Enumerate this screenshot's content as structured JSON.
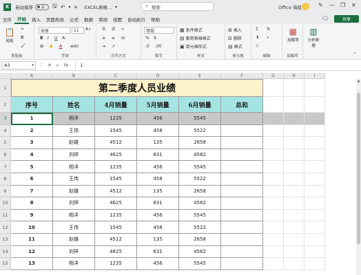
{
  "titlebar": {
    "logo": "X",
    "autosave_label": "自动保存",
    "autosave_state": "关",
    "filename": "EXCEL表格...",
    "search_placeholder": "搜索",
    "user": "Office 海蓝",
    "min": "—",
    "restore": "❐",
    "close": "✕"
  },
  "menu": {
    "items": [
      "文件",
      "开始",
      "插入",
      "页面布局",
      "公式",
      "数据",
      "审阅",
      "视图",
      "自动执行",
      "帮助"
    ],
    "active": "开始",
    "share_label": "共享"
  },
  "ribbon": {
    "clipboard": {
      "paste": "粘贴",
      "label": "剪贴板"
    },
    "font": {
      "name": "宋体",
      "size": "11",
      "label": "字体",
      "bold": "B",
      "italic": "I",
      "underline": "U",
      "wen": "wén"
    },
    "align": {
      "label": "对齐方式"
    },
    "number": {
      "format": "常规",
      "label": "数字",
      "percent": "%",
      "comma": "9"
    },
    "styles": {
      "conditional": "条件格式",
      "table": "套用表格格式",
      "cell": "单元格样式",
      "label": "样式"
    },
    "cells": {
      "insert": "插入",
      "delete": "删除",
      "format": "格式",
      "label": "单元格"
    },
    "editing": {
      "label": "编辑"
    },
    "addins": {
      "addin": "加载项",
      "label": "加载项"
    },
    "analyze": {
      "label": "分析数据"
    }
  },
  "formula_bar": {
    "name_box": "A3",
    "cancel": "✕",
    "enter": "✓",
    "fx": "fx",
    "content": "1"
  },
  "grid": {
    "columns": [
      "A",
      "B",
      "C",
      "D",
      "E",
      "F",
      "G",
      "H",
      "I"
    ],
    "row_numbers": [
      "1",
      "2",
      "3",
      "4",
      "5",
      "6",
      "7",
      "8",
      "9",
      "10",
      "11",
      "12",
      "13",
      "14",
      "15"
    ],
    "title": "第二季度人员业绩",
    "headers": [
      "序号",
      "姓名",
      "4月销量",
      "5月销量",
      "6月销量",
      "总和"
    ],
    "rows": [
      [
        "1",
        "杨洋",
        "1235",
        "456",
        "5545",
        ""
      ],
      [
        "2",
        "王伟",
        "1545",
        "458",
        "5522",
        ""
      ],
      [
        "3",
        "赵雄",
        "4512",
        "135",
        "2658",
        ""
      ],
      [
        "4",
        "刘祥",
        "4625",
        "631",
        "4582",
        ""
      ],
      [
        "5",
        "杨洋",
        "1235",
        "456",
        "5545",
        ""
      ],
      [
        "6",
        "王伟",
        "1545",
        "458",
        "5522",
        ""
      ],
      [
        "7",
        "赵雄",
        "4512",
        "135",
        "2658",
        ""
      ],
      [
        "8",
        "刘祥",
        "4625",
        "631",
        "4582",
        ""
      ],
      [
        "9",
        "杨洋",
        "1235",
        "456",
        "5545",
        ""
      ],
      [
        "10",
        "王伟",
        "1545",
        "458",
        "5522",
        ""
      ],
      [
        "11",
        "赵雄",
        "4512",
        "135",
        "2658",
        ""
      ],
      [
        "12",
        "刘祥",
        "4625",
        "631",
        "4582",
        ""
      ],
      [
        "13",
        "杨洋",
        "1235",
        "456",
        "5545",
        ""
      ]
    ],
    "selected_row": "3",
    "active_cell": "A3"
  },
  "colors": {
    "accent": "#1d6f42",
    "title_fill": "#fdf1c9",
    "header_fill": "#a4e4e2",
    "selection": "#c8c8c8"
  }
}
